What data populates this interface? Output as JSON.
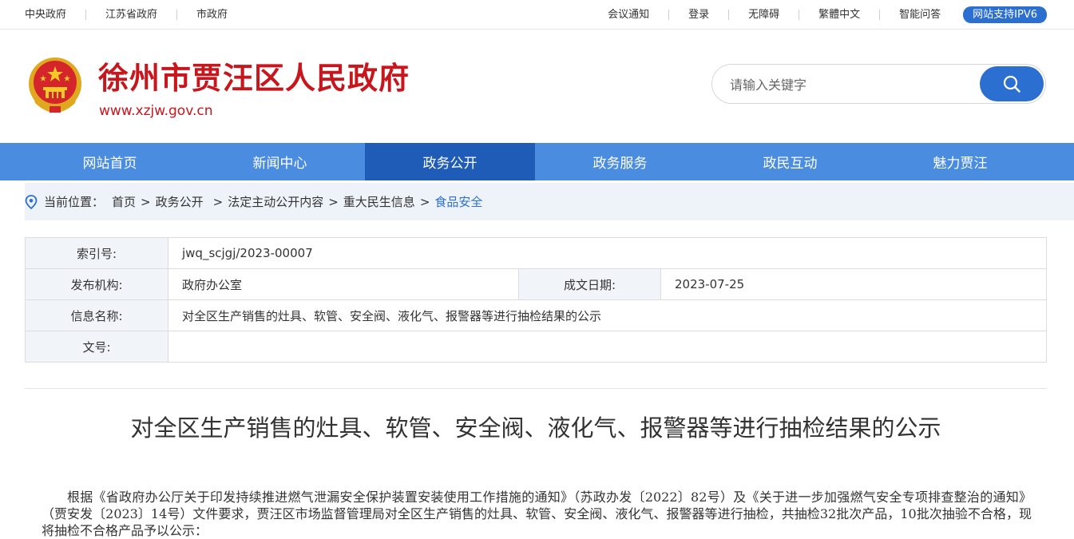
{
  "topbar": {
    "left_links": [
      "中央政府",
      "江苏省政府",
      "市政府"
    ],
    "right_links": [
      "会议通知",
      "登录",
      "无障碍",
      "繁體中文",
      "智能问答"
    ],
    "ipv6_badge": "网站支持IPV6"
  },
  "header": {
    "site_title": "徐州市贾汪区人民政府",
    "site_url": "www.xzjw.gov.cn",
    "emblem_icon": "national-emblem-icon"
  },
  "search": {
    "placeholder": "请输入关键字",
    "value": "",
    "button_icon": "search-icon"
  },
  "nav": {
    "items": [
      {
        "label": "网站首页",
        "active": false
      },
      {
        "label": "新闻中心",
        "active": false
      },
      {
        "label": "政务公开",
        "active": true
      },
      {
        "label": "政务服务",
        "active": false
      },
      {
        "label": "政民互动",
        "active": false
      },
      {
        "label": "魅力贾汪",
        "active": false
      }
    ]
  },
  "breadcrumb": {
    "icon": "location-pin-icon",
    "prefix": "当前位置：",
    "items": [
      "首页",
      "政务公开",
      "法定主动公开内容",
      "重大民生信息"
    ],
    "current": "食品安全",
    "separator": ">"
  },
  "meta": {
    "index_label": "索引号:",
    "index_value": "jwq_scjgj/2023-00007",
    "org_label": "发布机构:",
    "org_value": "政府办公室",
    "date_label": "成文日期:",
    "date_value": "2023-07-25",
    "name_label": "信息名称:",
    "name_value": "对全区生产销售的灶具、软管、安全阀、液化气、报警器等进行抽检结果的公示",
    "docno_label": "文号:",
    "docno_value": ""
  },
  "article": {
    "title": "对全区生产销售的灶具、软管、安全阀、液化气、报警器等进行抽检结果的公示",
    "paragraph": "根据《省政府办公厅关于印发持续推进燃气泄漏安全保护装置安装使用工作措施的通知》（苏政办发〔2022〕82号）及《关于进一步加强燃气安全专项排查整治的通知》（贾安发〔2023〕14号）文件要求，贾汪区市场监督管理局对全区生产销售的灶具、软管、安全阀、液化气、报警器等进行抽检，共抽检32批次产品，10批次抽验不合格，现将抽检不合格产品予以公示："
  },
  "colors": {
    "brand_red": "#c8161d",
    "nav_blue": "#4a8ce0",
    "nav_active": "#1f5cb8",
    "accent_blue": "#2b6fd1",
    "crumb_bg": "#eef3f9"
  }
}
